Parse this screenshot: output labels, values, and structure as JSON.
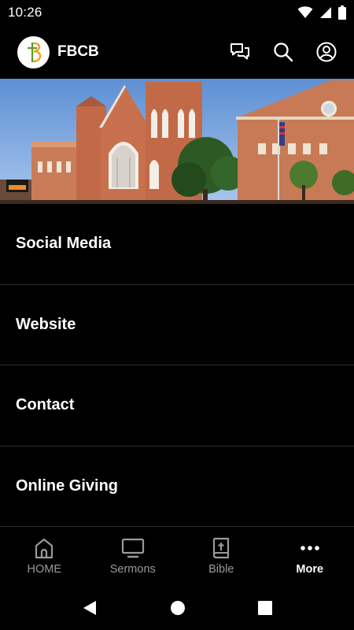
{
  "status_bar": {
    "time": "10:26",
    "icons": [
      "wifi-icon",
      "cellular-icon",
      "battery-icon"
    ]
  },
  "app_bar": {
    "logo_letter": "B",
    "title": "FBCB",
    "actions": [
      "chat-icon",
      "search-icon",
      "account-icon"
    ]
  },
  "banner": {
    "description_icon": "church-building-photo"
  },
  "menu": {
    "items": [
      {
        "label": "Social Media"
      },
      {
        "label": "Website"
      },
      {
        "label": "Contact"
      },
      {
        "label": "Online Giving"
      }
    ]
  },
  "bottom_nav": {
    "items": [
      {
        "label": "HOME",
        "icon": "church-icon",
        "active": false
      },
      {
        "label": "Sermons",
        "icon": "tv-icon",
        "active": false
      },
      {
        "label": "Bible",
        "icon": "bible-icon",
        "active": false
      },
      {
        "label": "More",
        "icon": "more-dots-icon",
        "active": true
      }
    ]
  },
  "system_nav": {
    "buttons": [
      "back-icon",
      "home-circle-icon",
      "recents-icon"
    ]
  },
  "colors": {
    "background": "#000000",
    "text_primary": "#ffffff",
    "text_inactive": "#9a9a9a",
    "divider": "#2f2f2f",
    "logo_green": "#5a9e2f",
    "logo_orange": "#f0a020"
  }
}
